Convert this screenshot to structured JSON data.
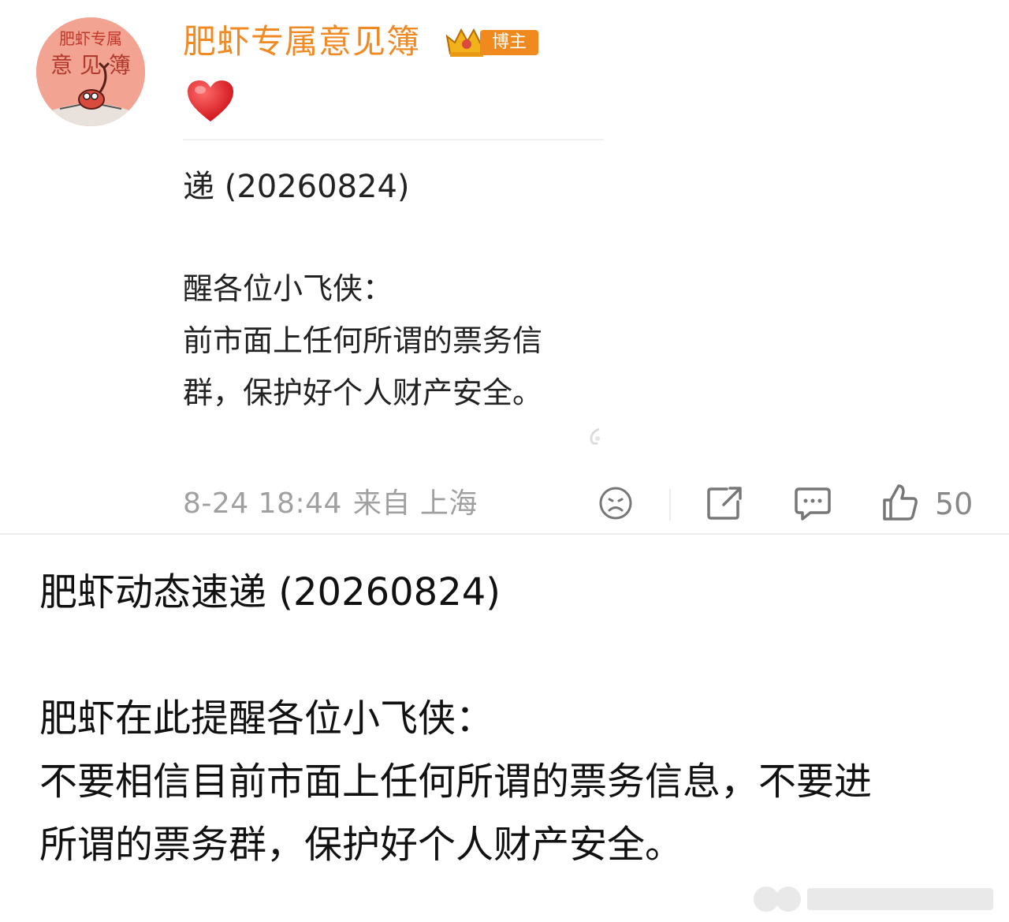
{
  "post": {
    "username": "肥虾专属意见簿",
    "badge_label": "博主",
    "avatar_lines": [
      "肥虾专属",
      "意 见 簿"
    ],
    "reaction_emoji": "❤",
    "image_excerpt": {
      "title": "递 (20260824)",
      "line1": "醒各位小飞侠：",
      "line2": "前市面上任何所谓的票务信",
      "line3": "群，保护好个人财产安全。"
    },
    "meta": {
      "date": "8-24 18:44",
      "source": "来自 上海"
    },
    "actions": {
      "like_count": "50"
    },
    "accent_color": "#f08a25"
  },
  "body": {
    "title": "肥虾动态速递 (20260824)",
    "line1": "肥虾在此提醒各位小飞侠：",
    "line2": "不要相信目前市面上任何所谓的票务信息，不要进",
    "line3": "所谓的票务群，保护好个人财产安全。"
  }
}
